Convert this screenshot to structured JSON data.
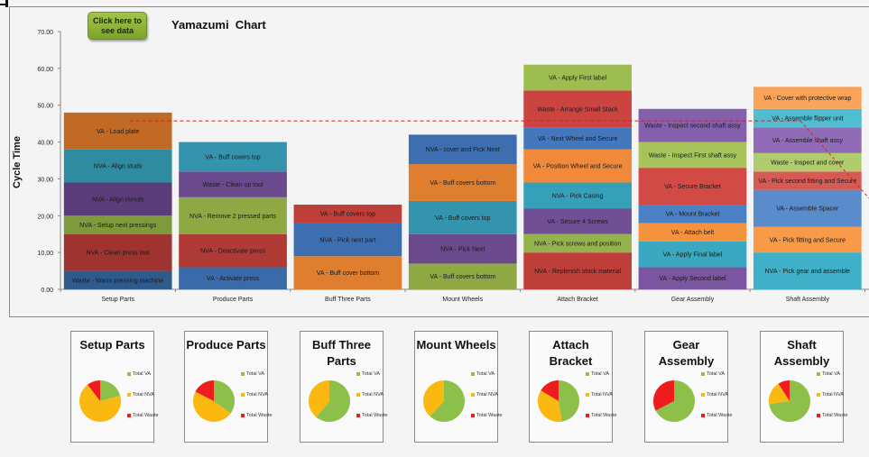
{
  "button": {
    "label": "Click here to see data"
  },
  "chart_data": {
    "type": "bar",
    "stacked": true,
    "title": "Yamazumi  Chart",
    "xlabel": "",
    "ylabel": "Cycle Time",
    "ylim": [
      0,
      70
    ],
    "yticks": [
      "0.00",
      "10.00",
      "20.00",
      "30.00",
      "40.00",
      "50.00",
      "60.00",
      "70.00"
    ],
    "grid": false,
    "takt_time": 45.75,
    "takt_line_style": "red dashed",
    "categories": [
      "Setup Parts",
      "Produce Parts",
      "Buff Three Parts",
      "Mount Wheels",
      "Attach Bracket",
      "Gear Assembly",
      "Shaft Assembly"
    ],
    "stacks": [
      {
        "category": "Setup Parts",
        "segments": [
          {
            "label": "Waste - Warm pressing machine",
            "value": 5,
            "color": "#2f5b8c"
          },
          {
            "label": "NVA - Clean press tool",
            "value": 10,
            "color": "#9e3330"
          },
          {
            "label": "NVA - Setup next pressings",
            "value": 5,
            "color": "#7f9a3a"
          },
          {
            "label": "NVA - Align rivnuts",
            "value": 9,
            "color": "#5a3d78"
          },
          {
            "label": "NVA - Align studs",
            "value": 9,
            "color": "#2f8ba0"
          },
          {
            "label": "VA - Load plate",
            "value": 10,
            "color": "#c06a26"
          }
        ]
      },
      {
        "category": "Produce Parts",
        "segments": [
          {
            "label": "VA - Activate press",
            "value": 6,
            "color": "#3a6aa8"
          },
          {
            "label": "NVA - Deactivate press",
            "value": 9,
            "color": "#b03a36"
          },
          {
            "label": "NVA - Remove 2 pressed parts",
            "value": 10,
            "color": "#8ea844"
          },
          {
            "label": "Waste - Clean up tool",
            "value": 7,
            "color": "#6a4a8c"
          },
          {
            "label": "VA - Buff covers top",
            "value": 8,
            "color": "#3494ae"
          }
        ]
      },
      {
        "category": "Buff Three Parts",
        "segments": [
          {
            "label": "VA - Buff cover bottom",
            "value": 9,
            "color": "#e07e30"
          },
          {
            "label": "NVA - Pick next part",
            "value": 9,
            "color": "#3d6fb0"
          },
          {
            "label": "VA - Buff covers top",
            "value": 5,
            "color": "#be3e3a"
          }
        ]
      },
      {
        "category": "Mount Wheels",
        "segments": [
          {
            "label": "VA - Buff covers bottom",
            "value": 7,
            "color": "#8ea844"
          },
          {
            "label": "NVA - Pick Next",
            "value": 8,
            "color": "#6a4a8c"
          },
          {
            "label": "VA - Buff covers top",
            "value": 9,
            "color": "#3494ae"
          },
          {
            "label": "VA - Buff covers bottom",
            "value": 10,
            "color": "#e07e30"
          },
          {
            "label": "NVA - cover and Pick Next",
            "value": 8,
            "color": "#3d6fb0"
          }
        ]
      },
      {
        "category": "Attach Bracket",
        "segments": [
          {
            "label": "NVA - Replenish stock material",
            "value": 10,
            "color": "#be3e3a"
          },
          {
            "label": "NVA - Pick screws and position",
            "value": 5,
            "color": "#96b24c"
          },
          {
            "label": "VA - Secure 4 Screws",
            "value": 7,
            "color": "#714f94"
          },
          {
            "label": "NVA - Pick Casing",
            "value": 7,
            "color": "#36a0b8"
          },
          {
            "label": "VA - Position Wheel and Secure",
            "value": 9,
            "color": "#f08a3a"
          },
          {
            "label": "VA - Next Wheel and Secure",
            "value": 6,
            "color": "#4477bb"
          },
          {
            "label": "Waste - Arrange Small Stack",
            "value": 10,
            "color": "#cc4440"
          },
          {
            "label": "VA - Apply First label",
            "value": 7,
            "color": "#9ebd50"
          }
        ]
      },
      {
        "category": "Gear Assembly",
        "segments": [
          {
            "label": "VA - Apply Second label",
            "value": 6,
            "color": "#7a56a0"
          },
          {
            "label": "VA - Apply Final label",
            "value": 7,
            "color": "#3aa8c0"
          },
          {
            "label": "VA - Attach belt",
            "value": 5,
            "color": "#f5923e"
          },
          {
            "label": "VA - Mount Bracket",
            "value": 5,
            "color": "#4a80c4"
          },
          {
            "label": "VA - Secure Bracket",
            "value": 10,
            "color": "#d24a46"
          },
          {
            "label": "Waste - Inspect First shaft assy",
            "value": 7,
            "color": "#a6c45a"
          },
          {
            "label": "Waste - Inspect second shaft assy",
            "value": 9,
            "color": "#8460ac"
          }
        ]
      },
      {
        "category": "Shaft Assembly",
        "segments": [
          {
            "label": "NVA - Pick gear and assemble",
            "value": 10,
            "color": "#40b0c8"
          },
          {
            "label": "VA - Pick fitting and Secure",
            "value": 7,
            "color": "#f89a48"
          },
          {
            "label": "VA - Assemble Spacer",
            "value": 10,
            "color": "#5a8ccc"
          },
          {
            "label": "VA - Pick second fitting and Secure",
            "value": 5,
            "color": "#d85a54"
          },
          {
            "label": "Waste - Inspect and cover",
            "value": 5,
            "color": "#b0cc6c"
          },
          {
            "label": "VA - Assemble shaft assy",
            "value": 7,
            "color": "#906cb6"
          },
          {
            "label": "VA - Assemble flipper unit",
            "value": 5,
            "color": "#52bcd0"
          },
          {
            "label": "VA - Cover with protective wrap",
            "value": 6,
            "color": "#faa45a"
          }
        ]
      }
    ],
    "pies": [
      {
        "title": "Setup Parts",
        "values": {
          "Total VA": 10,
          "Total NVA": 33,
          "Total Waste": 5
        }
      },
      {
        "title": "Produce Parts",
        "values": {
          "Total VA": 14,
          "Total NVA": 19,
          "Total Waste": 7
        }
      },
      {
        "title": "Buff Three Parts",
        "values": {
          "Total VA": 14,
          "Total NVA": 9,
          "Total Waste": 0
        }
      },
      {
        "title": "Mount Wheels",
        "values": {
          "Total VA": 26,
          "Total NVA": 16,
          "Total Waste": 0
        }
      },
      {
        "title": "Attach Bracket",
        "values": {
          "Total VA": 29,
          "Total NVA": 22,
          "Total Waste": 10
        }
      },
      {
        "title": "Gear Assembly",
        "values": {
          "Total VA": 33,
          "Total NVA": 0,
          "Total Waste": 16
        }
      },
      {
        "title": "Shaft Assembly",
        "values": {
          "Total VA": 40,
          "Total NVA": 10,
          "Total Waste": 5
        }
      }
    ],
    "pie_legend": [
      {
        "label": "Total VA",
        "color": "#8cc04a"
      },
      {
        "label": "Total NVA",
        "color": "#fbb810"
      },
      {
        "label": "Total Waste",
        "color": "#ee1c1c"
      }
    ]
  }
}
